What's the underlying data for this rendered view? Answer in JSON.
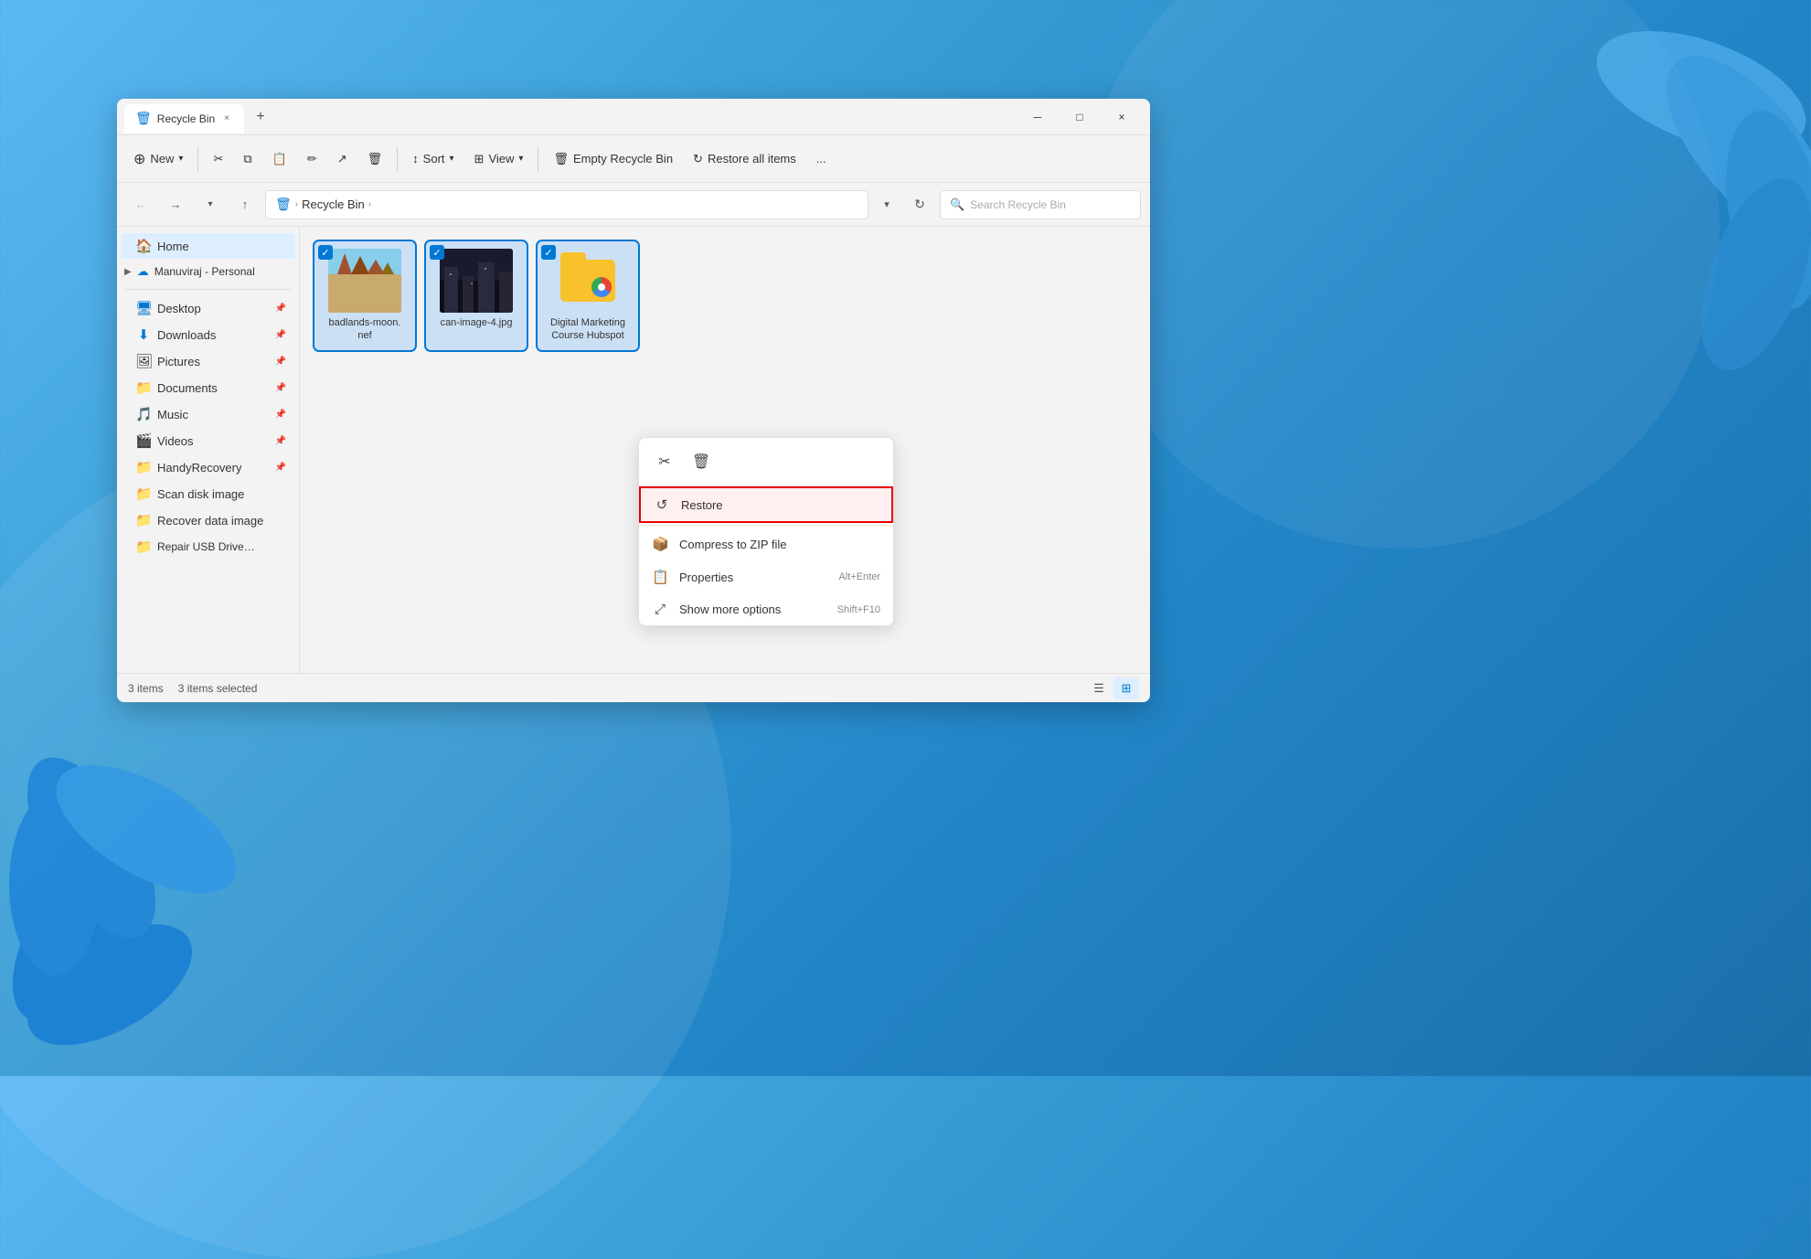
{
  "window": {
    "title": "Recycle Bin",
    "tab_label": "Recycle Bin",
    "close_label": "×",
    "minimize_label": "─",
    "maximize_label": "□"
  },
  "toolbar": {
    "new_label": "New",
    "sort_label": "Sort",
    "view_label": "View",
    "empty_bin_label": "Empty Recycle Bin",
    "restore_all_label": "Restore all items",
    "more_label": "..."
  },
  "addressbar": {
    "path_icon": "🗑",
    "path_label": "Recycle Bin",
    "path_chevron": ">",
    "search_placeholder": "Search Recycle Bin"
  },
  "sidebar": {
    "home_label": "Home",
    "onedrive_label": "Manuviraj - Personal",
    "desktop_label": "Desktop",
    "downloads_label": "Downloads",
    "pictures_label": "Pictures",
    "documents_label": "Documents",
    "music_label": "Music",
    "videos_label": "Videos",
    "handyrecovery_label": "HandyRecovery",
    "scandisk_label": "Scan disk image",
    "recoverdata_label": "Recover data image",
    "repairusb_label": "Repair USB Drive Sol"
  },
  "files": [
    {
      "name": "badlands-moon.\nnef",
      "type": "nef",
      "selected": true
    },
    {
      "name": "can-image-4.jpg",
      "type": "jpg",
      "selected": true
    },
    {
      "name": "Digital Marketing\nCourse Hubspot",
      "type": "folder",
      "selected": true
    }
  ],
  "statusbar": {
    "items_count": "3 items",
    "items_selected": "3 items selected"
  },
  "context_menu": {
    "cut_icon": "✂",
    "delete_icon": "🗑",
    "restore_label": "Restore",
    "compress_label": "Compress to ZIP file",
    "properties_label": "Properties",
    "properties_shortcut": "Alt+Enter",
    "more_options_label": "Show more options",
    "more_options_shortcut": "Shift+F10"
  }
}
